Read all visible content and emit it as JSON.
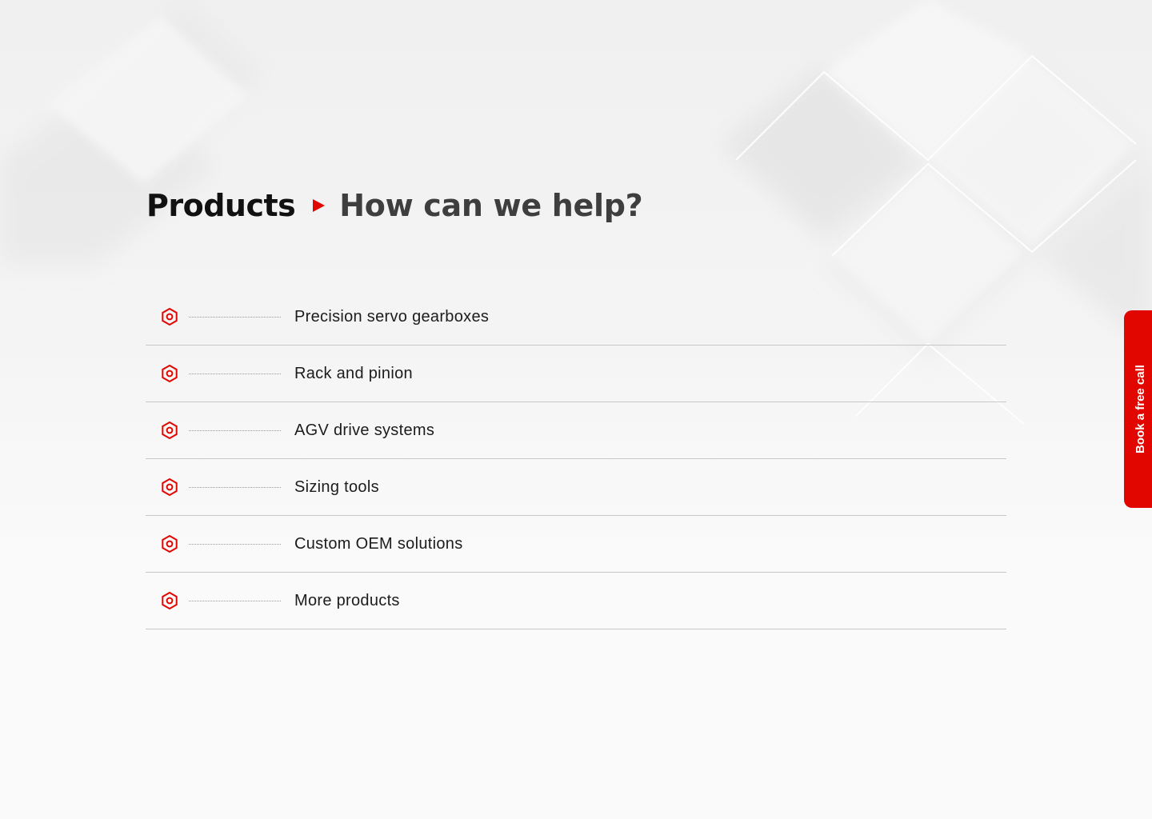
{
  "breadcrumb": {
    "root": "Products",
    "current": "How can we help?"
  },
  "products": [
    {
      "label": "Precision servo gearboxes"
    },
    {
      "label": "Rack and pinion"
    },
    {
      "label": "AGV drive systems"
    },
    {
      "label": "Sizing tools"
    },
    {
      "label": "Custom OEM solutions"
    },
    {
      "label": "More products"
    }
  ],
  "cta": {
    "label": "Book a free call"
  },
  "colors": {
    "accent": "#e10600",
    "heading": "#111111",
    "subheading": "#3e3e3e",
    "divider": "#c8c8c8"
  },
  "icons": {
    "list_item": "hex-nut-icon",
    "separator": "triangle-right-icon"
  }
}
